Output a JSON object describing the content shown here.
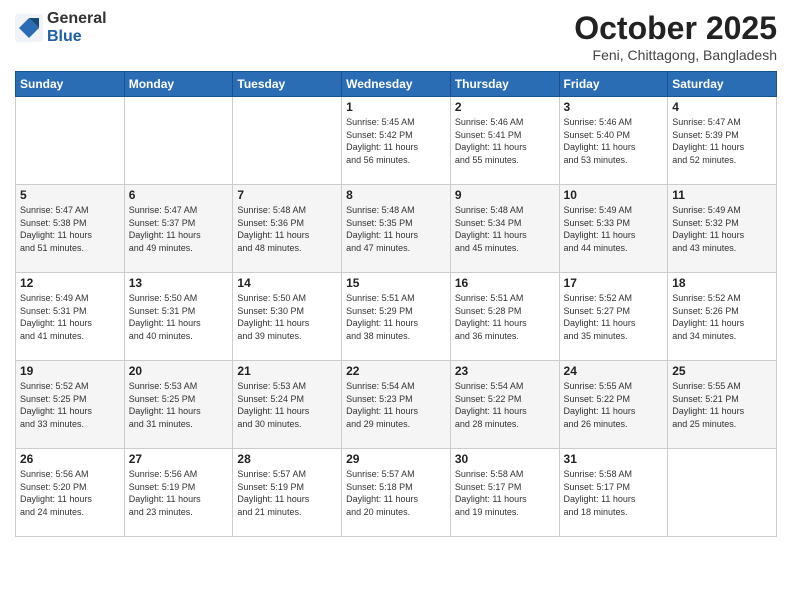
{
  "logo": {
    "general": "General",
    "blue": "Blue"
  },
  "title": {
    "month": "October 2025",
    "location": "Feni, Chittagong, Bangladesh"
  },
  "weekdays": [
    "Sunday",
    "Monday",
    "Tuesday",
    "Wednesday",
    "Thursday",
    "Friday",
    "Saturday"
  ],
  "weeks": [
    [
      {
        "day": "",
        "info": ""
      },
      {
        "day": "",
        "info": ""
      },
      {
        "day": "",
        "info": ""
      },
      {
        "day": "1",
        "info": "Sunrise: 5:45 AM\nSunset: 5:42 PM\nDaylight: 11 hours\nand 56 minutes."
      },
      {
        "day": "2",
        "info": "Sunrise: 5:46 AM\nSunset: 5:41 PM\nDaylight: 11 hours\nand 55 minutes."
      },
      {
        "day": "3",
        "info": "Sunrise: 5:46 AM\nSunset: 5:40 PM\nDaylight: 11 hours\nand 53 minutes."
      },
      {
        "day": "4",
        "info": "Sunrise: 5:47 AM\nSunset: 5:39 PM\nDaylight: 11 hours\nand 52 minutes."
      }
    ],
    [
      {
        "day": "5",
        "info": "Sunrise: 5:47 AM\nSunset: 5:38 PM\nDaylight: 11 hours\nand 51 minutes."
      },
      {
        "day": "6",
        "info": "Sunrise: 5:47 AM\nSunset: 5:37 PM\nDaylight: 11 hours\nand 49 minutes."
      },
      {
        "day": "7",
        "info": "Sunrise: 5:48 AM\nSunset: 5:36 PM\nDaylight: 11 hours\nand 48 minutes."
      },
      {
        "day": "8",
        "info": "Sunrise: 5:48 AM\nSunset: 5:35 PM\nDaylight: 11 hours\nand 47 minutes."
      },
      {
        "day": "9",
        "info": "Sunrise: 5:48 AM\nSunset: 5:34 PM\nDaylight: 11 hours\nand 45 minutes."
      },
      {
        "day": "10",
        "info": "Sunrise: 5:49 AM\nSunset: 5:33 PM\nDaylight: 11 hours\nand 44 minutes."
      },
      {
        "day": "11",
        "info": "Sunrise: 5:49 AM\nSunset: 5:32 PM\nDaylight: 11 hours\nand 43 minutes."
      }
    ],
    [
      {
        "day": "12",
        "info": "Sunrise: 5:49 AM\nSunset: 5:31 PM\nDaylight: 11 hours\nand 41 minutes."
      },
      {
        "day": "13",
        "info": "Sunrise: 5:50 AM\nSunset: 5:31 PM\nDaylight: 11 hours\nand 40 minutes."
      },
      {
        "day": "14",
        "info": "Sunrise: 5:50 AM\nSunset: 5:30 PM\nDaylight: 11 hours\nand 39 minutes."
      },
      {
        "day": "15",
        "info": "Sunrise: 5:51 AM\nSunset: 5:29 PM\nDaylight: 11 hours\nand 38 minutes."
      },
      {
        "day": "16",
        "info": "Sunrise: 5:51 AM\nSunset: 5:28 PM\nDaylight: 11 hours\nand 36 minutes."
      },
      {
        "day": "17",
        "info": "Sunrise: 5:52 AM\nSunset: 5:27 PM\nDaylight: 11 hours\nand 35 minutes."
      },
      {
        "day": "18",
        "info": "Sunrise: 5:52 AM\nSunset: 5:26 PM\nDaylight: 11 hours\nand 34 minutes."
      }
    ],
    [
      {
        "day": "19",
        "info": "Sunrise: 5:52 AM\nSunset: 5:25 PM\nDaylight: 11 hours\nand 33 minutes."
      },
      {
        "day": "20",
        "info": "Sunrise: 5:53 AM\nSunset: 5:25 PM\nDaylight: 11 hours\nand 31 minutes."
      },
      {
        "day": "21",
        "info": "Sunrise: 5:53 AM\nSunset: 5:24 PM\nDaylight: 11 hours\nand 30 minutes."
      },
      {
        "day": "22",
        "info": "Sunrise: 5:54 AM\nSunset: 5:23 PM\nDaylight: 11 hours\nand 29 minutes."
      },
      {
        "day": "23",
        "info": "Sunrise: 5:54 AM\nSunset: 5:22 PM\nDaylight: 11 hours\nand 28 minutes."
      },
      {
        "day": "24",
        "info": "Sunrise: 5:55 AM\nSunset: 5:22 PM\nDaylight: 11 hours\nand 26 minutes."
      },
      {
        "day": "25",
        "info": "Sunrise: 5:55 AM\nSunset: 5:21 PM\nDaylight: 11 hours\nand 25 minutes."
      }
    ],
    [
      {
        "day": "26",
        "info": "Sunrise: 5:56 AM\nSunset: 5:20 PM\nDaylight: 11 hours\nand 24 minutes."
      },
      {
        "day": "27",
        "info": "Sunrise: 5:56 AM\nSunset: 5:19 PM\nDaylight: 11 hours\nand 23 minutes."
      },
      {
        "day": "28",
        "info": "Sunrise: 5:57 AM\nSunset: 5:19 PM\nDaylight: 11 hours\nand 21 minutes."
      },
      {
        "day": "29",
        "info": "Sunrise: 5:57 AM\nSunset: 5:18 PM\nDaylight: 11 hours\nand 20 minutes."
      },
      {
        "day": "30",
        "info": "Sunrise: 5:58 AM\nSunset: 5:17 PM\nDaylight: 11 hours\nand 19 minutes."
      },
      {
        "day": "31",
        "info": "Sunrise: 5:58 AM\nSunset: 5:17 PM\nDaylight: 11 hours\nand 18 minutes."
      },
      {
        "day": "",
        "info": ""
      }
    ]
  ]
}
